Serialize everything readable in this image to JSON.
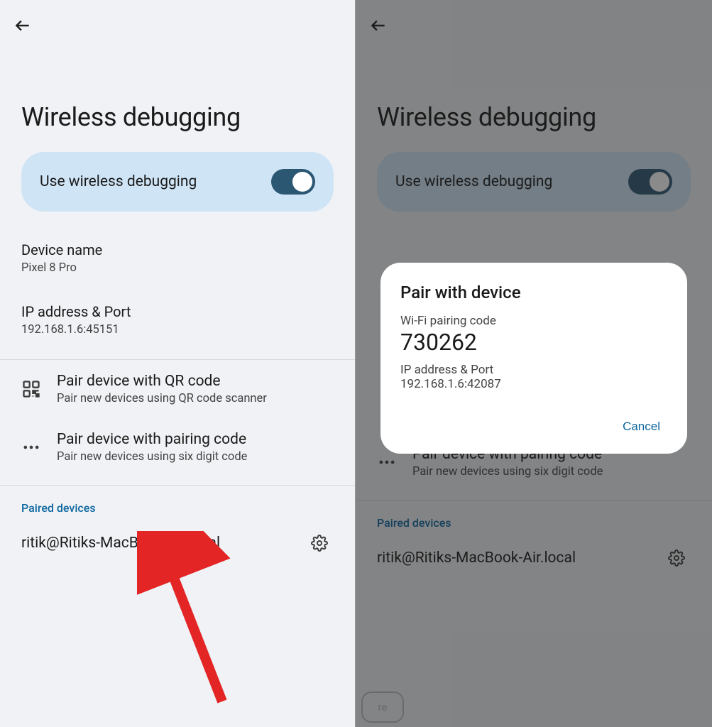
{
  "left": {
    "page_title": "Wireless debugging",
    "toggle": {
      "label": "Use wireless debugging",
      "on": true
    },
    "device_name": {
      "label": "Device name",
      "value": "Pixel 8 Pro"
    },
    "ip_port": {
      "label": "IP address & Port",
      "value": "192.168.1.6:45151"
    },
    "action_qr": {
      "title": "Pair device with QR code",
      "sub": "Pair new devices using QR code scanner"
    },
    "action_code": {
      "title": "Pair device with pairing code",
      "sub": "Pair new devices using six digit code"
    },
    "paired_header": "Paired devices",
    "paired_device": "ritik@Ritiks-MacBook-Air.local"
  },
  "right": {
    "page_title": "Wireless debugging",
    "toggle": {
      "label": "Use wireless debugging",
      "on": true
    },
    "action_code": {
      "title": "Pair device with pairing code",
      "sub": "Pair new devices using six digit code"
    },
    "paired_header": "Paired devices",
    "paired_device": "ritik@Ritiks-MacBook-Air.local",
    "more_label": "re",
    "dialog": {
      "title": "Pair with device",
      "pairing_label": "Wi-Fi pairing code",
      "pairing_code": "730262",
      "ip_label": "IP address & Port",
      "ip_value": "192.168.1.6:42087",
      "cancel": "Cancel"
    }
  }
}
